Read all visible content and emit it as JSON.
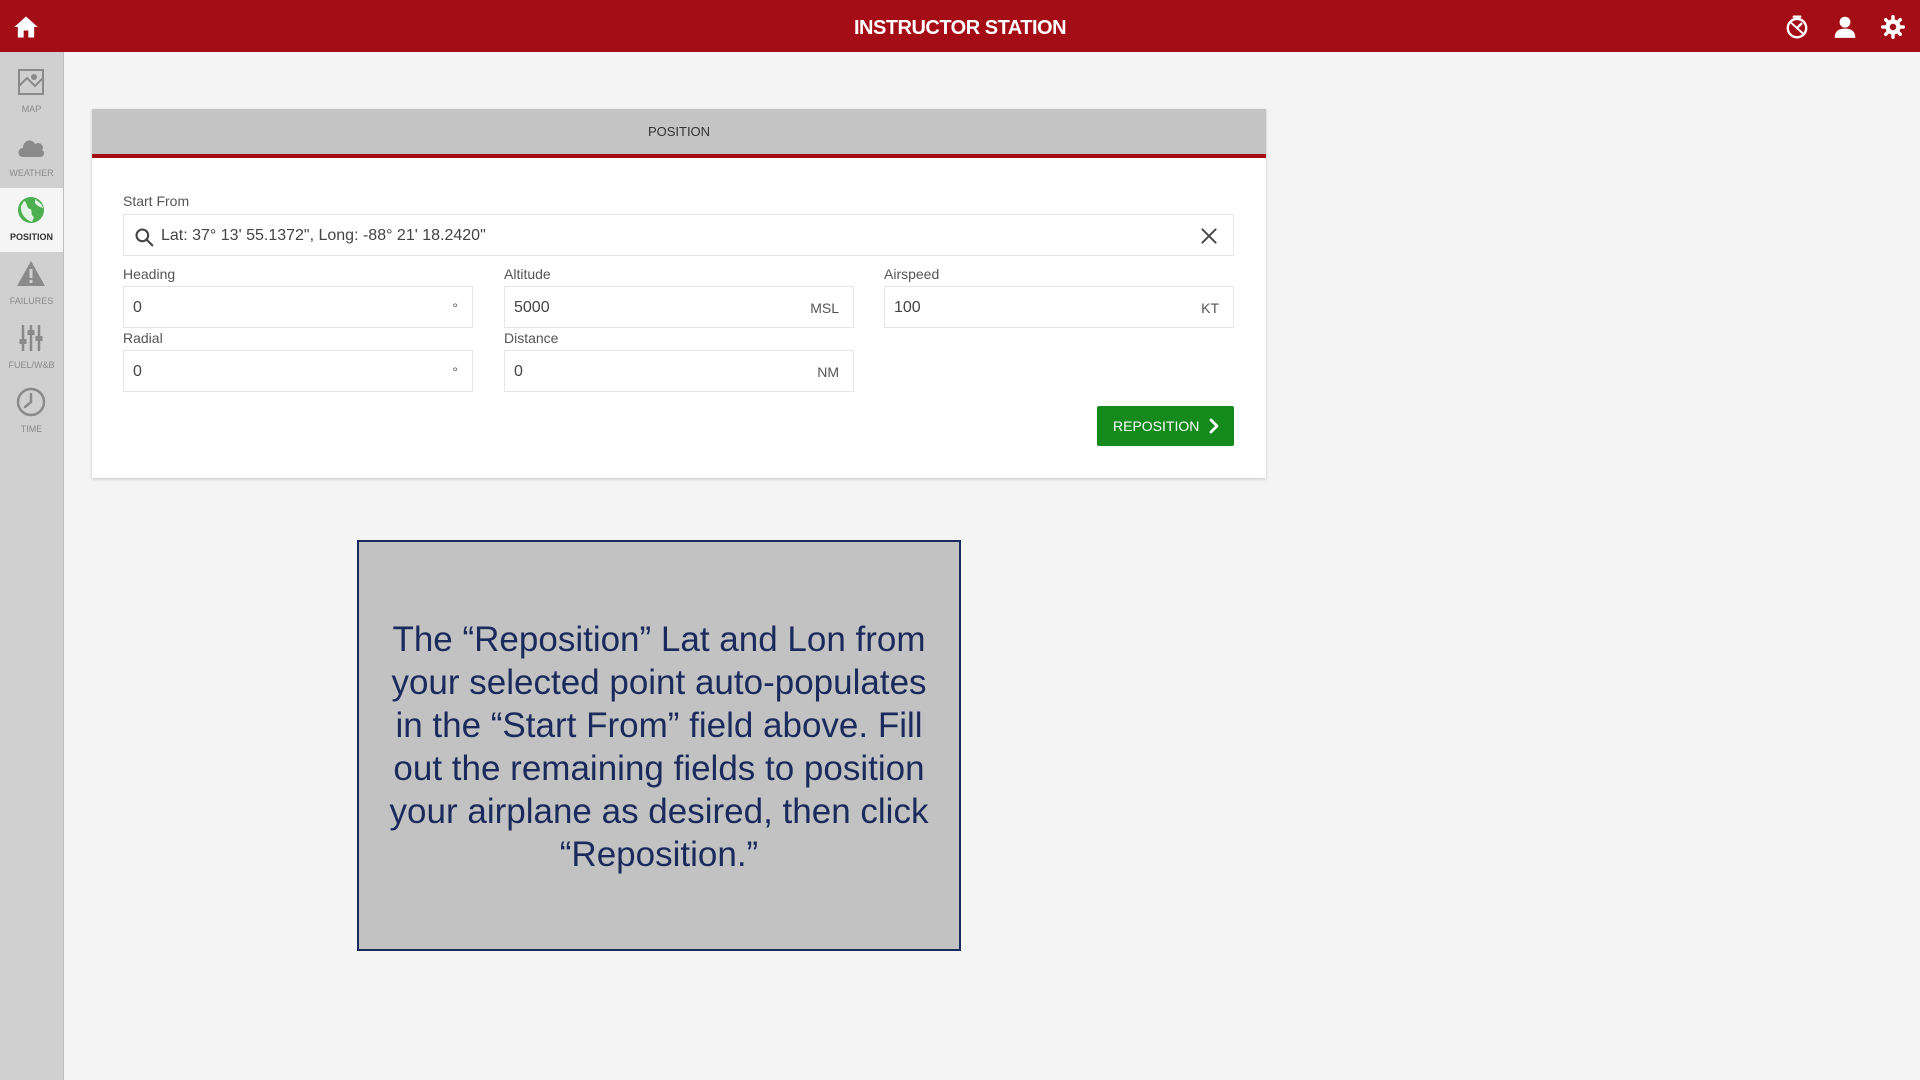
{
  "app": {
    "title": "INSTRUCTOR STATION"
  },
  "header_icons": [
    "home-icon",
    "timer-icon",
    "user-icon",
    "gear-icon"
  ],
  "colors": {
    "brand": "#a50d16",
    "action": "#148a1d",
    "note_text": "#1b2a5c"
  },
  "sidebar": {
    "items": [
      {
        "label": "MAP",
        "icon": "map-icon"
      },
      {
        "label": "WEATHER",
        "icon": "cloud-icon"
      },
      {
        "label": "POSITION",
        "icon": "globe-icon",
        "active": true
      },
      {
        "label": "FAILURES",
        "icon": "warning-icon"
      },
      {
        "label": "FUEL/W&B",
        "icon": "sliders-icon"
      },
      {
        "label": "TIME",
        "icon": "clock-icon"
      }
    ]
  },
  "panel": {
    "title": "POSITION",
    "start_from": {
      "label": "Start From",
      "value": "Lat: 37° 13' 55.1372\", Long: -88° 21' 18.2420\""
    },
    "heading": {
      "label": "Heading",
      "value": "0",
      "unit": "°"
    },
    "altitude": {
      "label": "Altitude",
      "value": "5000",
      "unit": "MSL"
    },
    "airspeed": {
      "label": "Airspeed",
      "value": "100",
      "unit": "KT"
    },
    "radial": {
      "label": "Radial",
      "value": "0",
      "unit": "°"
    },
    "distance": {
      "label": "Distance",
      "value": "0",
      "unit": "NM"
    },
    "reposition_label": "REPOSITION"
  },
  "note": {
    "text": "The “Reposition” Lat and Lon from your selected point auto-populates in the “Start From” field above.  Fill out the remaining fields to position your airplane as desired, then click “Reposition.”"
  }
}
